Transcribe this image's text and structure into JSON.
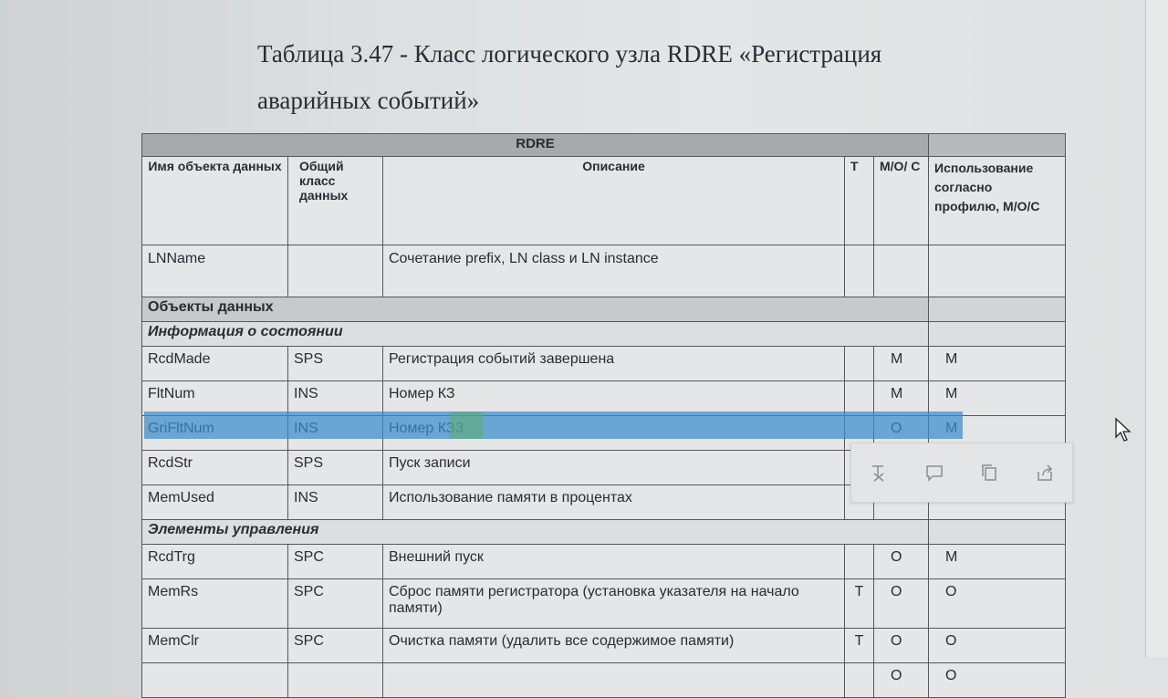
{
  "caption": {
    "line1": "Таблица 3.47 - Класс логического узла RDRE «Регистрация",
    "line2": "аварийных событий»"
  },
  "table": {
    "title": "RDRE",
    "headers": {
      "name": "Имя объекта данных",
      "class": "Общий класс данных",
      "desc": "Описание",
      "t": "T",
      "moc": "M/O/ C",
      "use": "Использование согласно профилю, M/O/C"
    },
    "lnname": {
      "name": "LNName",
      "desc": "Сочетание prefix, LN class и LN instance"
    },
    "section_objects": "Объекты данных",
    "subsection_status": "Информация о состоянии",
    "status_rows": [
      {
        "name": "RcdMade",
        "class": "SPS",
        "desc": "Регистрация событий завершена",
        "t": "",
        "moc": "M",
        "use": "M"
      },
      {
        "name": "FltNum",
        "class": "INS",
        "desc": "Номер КЗ",
        "t": "",
        "moc": "M",
        "use": "M"
      },
      {
        "name": "GriFltNum",
        "class": "INS",
        "desc": "Номер КЗЗ",
        "t": "",
        "moc": "O",
        "use": "M"
      },
      {
        "name": "RcdStr",
        "class": "SPS",
        "desc": "Пуск записи",
        "t": "",
        "moc": "",
        "use": ""
      },
      {
        "name": "MemUsed",
        "class": "INS",
        "desc": "Использование памяти в процентах",
        "t": "",
        "moc": "",
        "use": ""
      }
    ],
    "subsection_control": "Элементы управления",
    "control_rows": [
      {
        "name": "RcdTrg",
        "class": "SPC",
        "desc": "Внешний пуск",
        "t": "",
        "moc": "O",
        "use": "M"
      },
      {
        "name": "MemRs",
        "class": "SPC",
        "desc": "Сброс памяти регистратора (установка указателя на начало памяти)",
        "t": "T",
        "moc": "O",
        "use": "O"
      },
      {
        "name": "MemClr",
        "class": "SPC",
        "desc": "Очистка памяти (удалить все содержимое памяти)",
        "t": "T",
        "moc": "O",
        "use": "O"
      },
      {
        "name": "",
        "class": "",
        "desc": "",
        "t": "",
        "moc": "O",
        "use": "O"
      }
    ]
  },
  "toolbar": {
    "icons": [
      "clear-format-icon",
      "comment-icon",
      "copy-icon",
      "share-icon"
    ]
  },
  "colors": {
    "selection": "#3c8ccd",
    "table_header": "#a7a9aa",
    "border": "#55585c"
  }
}
